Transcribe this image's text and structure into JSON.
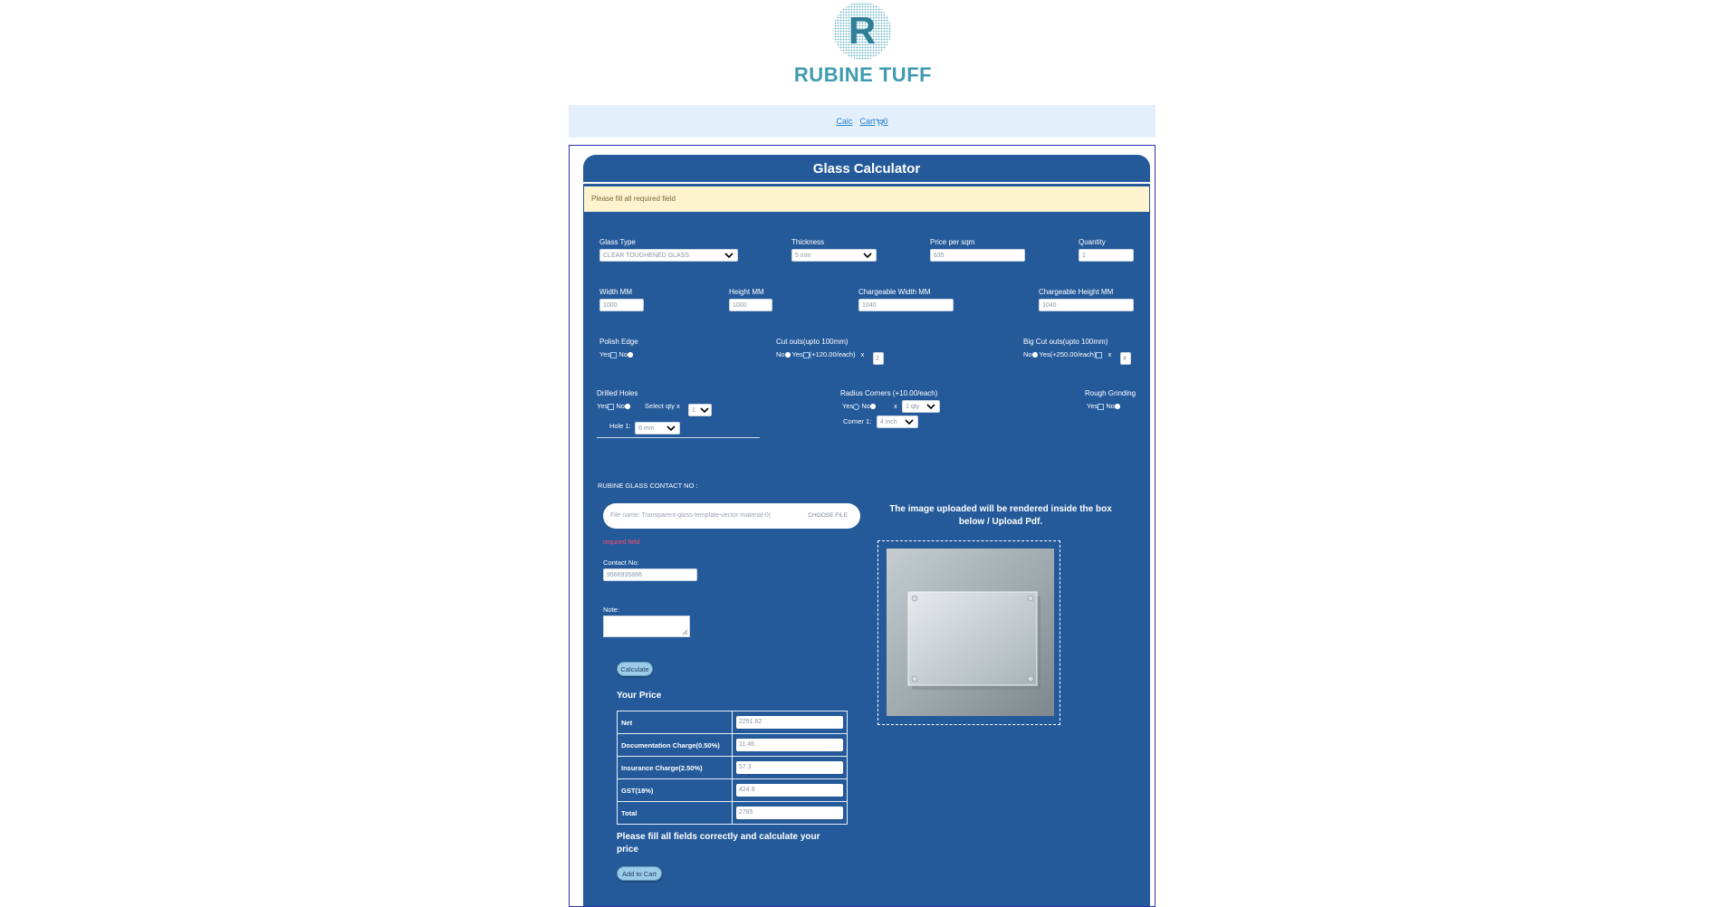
{
  "brand": {
    "name": "RUBINE TUFF",
    "logo_letter": "R"
  },
  "nav": {
    "calc_label": "Calc",
    "cart_label": "Cart",
    "cart_count": "0"
  },
  "calculator": {
    "title": "Glass Calculator",
    "alert": "Please fill all required field",
    "glass_type": {
      "label": "Glass Type",
      "value": "CLEAR TOUGHENED GLASS"
    },
    "thickness": {
      "label": "Thickness",
      "value": "5 mm"
    },
    "price_per_sqm": {
      "label": "Price per sqm",
      "value": "635"
    },
    "quantity": {
      "label": "Quantity",
      "value": "1"
    },
    "width": {
      "label": "Width MM",
      "value": "1000"
    },
    "height": {
      "label": "Height MM",
      "value": "1000"
    },
    "chargeable_width": {
      "label": "Chargeable Width MM",
      "value": "1040"
    },
    "chargeable_height": {
      "label": "Chargeable Height MM",
      "value": "1040"
    },
    "polish_edge": {
      "label": "Polish Edge",
      "yes": "Yes",
      "no": "No"
    },
    "cut_outs": {
      "label": "Cut outs(upto 100mm)",
      "no": "No",
      "yes": "Yes",
      "price": "(+120.00/each)",
      "x": "x",
      "qty": "2"
    },
    "big_cut_outs": {
      "label": "Big Cut outs(upto 100mm)",
      "no": "No",
      "yes": "Yes",
      "price": "(+250.00/each)",
      "x": "x",
      "qty": "4"
    },
    "drilled_holes": {
      "label": "Drilled Holes",
      "yes": "Yes",
      "no": "No",
      "select_qty": "Select qty x",
      "qty": "1",
      "hole_label": "Hole 1:",
      "hole_value": "6 mm"
    },
    "radius_corners": {
      "label": "Radius Corners (+10.00/each)",
      "yes": "Yes",
      "no": "No",
      "x": "x",
      "qty": "1 qty",
      "corner_label": "Corner 1:",
      "corner_value": "4 inch"
    },
    "rough_grinding": {
      "label": "Rough Grinding",
      "yes": "Yes",
      "no": "No"
    },
    "contact_heading": "RUBINE GLASS CONTACT NO :",
    "file": {
      "name": "File name: Transparent-glass-template-vector-material-0(",
      "button": "CHOOSE FILE"
    },
    "required": "required field",
    "contact": {
      "label": "Contact No:",
      "value": "9566935886"
    },
    "note": {
      "label": "Note:"
    },
    "calculate_label": "Calculate",
    "your_price": "Your Price",
    "prices": [
      {
        "label": "Net",
        "value": "2291.82"
      },
      {
        "label": "Documentation Charge(0.50%)",
        "value": "11.46"
      },
      {
        "label": "Insurance Charge(2.50%)",
        "value": "57.3"
      },
      {
        "label": "GST(18%)",
        "value": "424.9"
      },
      {
        "label": "Total",
        "value": "2785"
      }
    ],
    "notice": "Please fill all fields correctly and calculate your price",
    "add_to_cart_label": "Add to Cart",
    "upload_text": "The image uploaded will be rendered inside the box below / Upload Pdf."
  },
  "colors": {
    "panel": "#255a9a",
    "accent": "#3f9bb0",
    "alert_bg": "#fdf3cf",
    "error": "#ff4a74"
  }
}
